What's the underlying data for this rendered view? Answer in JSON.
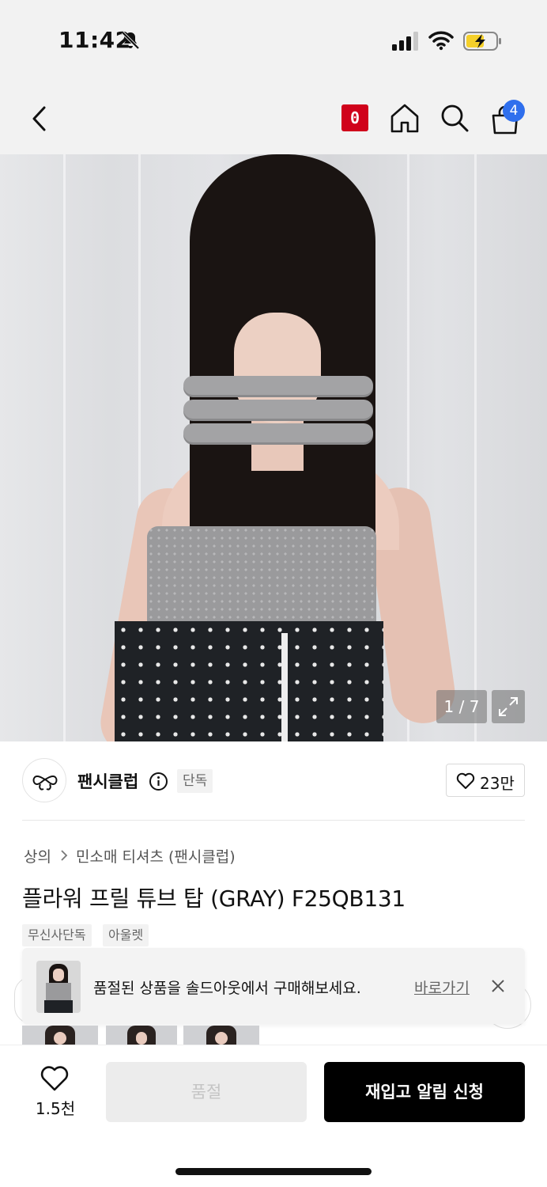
{
  "status_bar": {
    "time": "11:42"
  },
  "nav": {
    "point_badge": "0",
    "cart_count": "4"
  },
  "gallery": {
    "counter": "1 / 7"
  },
  "brand": {
    "name": "팬시클럽",
    "exclusive_tag": "단독",
    "like_count": "23만"
  },
  "product": {
    "category_root": "상의",
    "category_sub": "민소매 티셔츠 (팬시클럽)",
    "title": "플라워 프릴 튜브 탑 (GRAY) F25QB131",
    "tags": [
      "무신사단독",
      "아울렛"
    ]
  },
  "toast": {
    "message": "품절된 상품을 솔드아웃에서 구매해보세요.",
    "link": "바로가기"
  },
  "bottom_bar": {
    "wish_count": "1.5천",
    "soldout_label": "품절",
    "restock_label": "재입고 알림 신청"
  },
  "colors": {
    "point_red": "#d0021b",
    "cart_blue": "#2f6fed",
    "primary_black": "#000000"
  }
}
